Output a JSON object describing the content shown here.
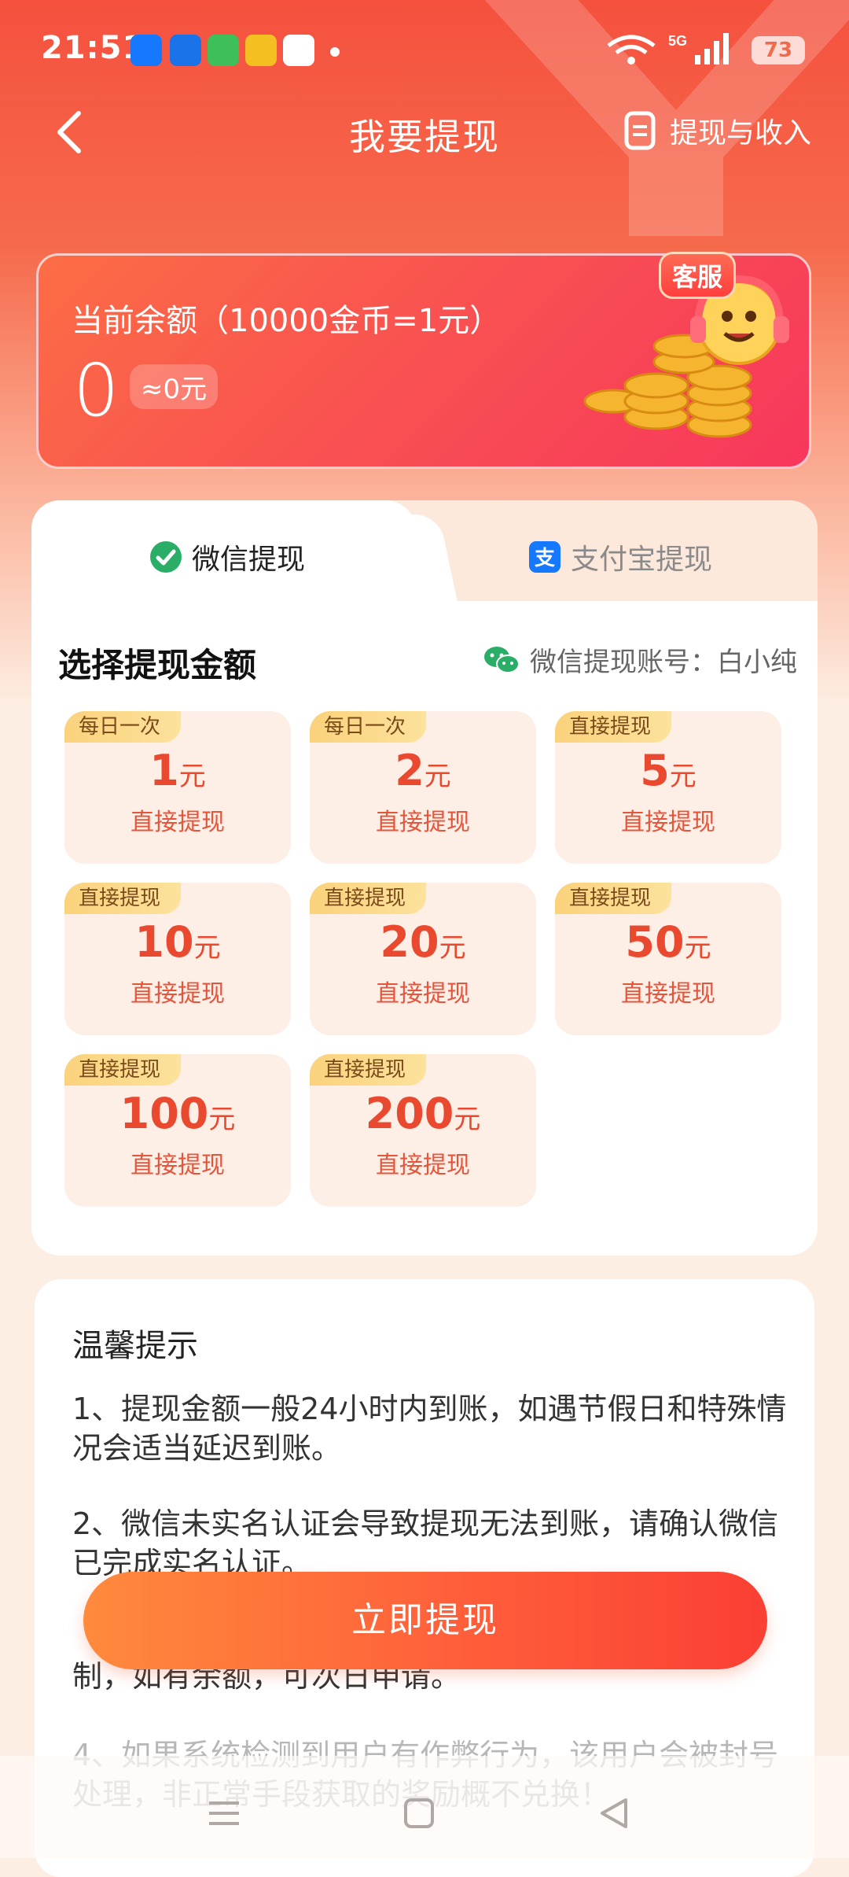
{
  "status_bar": {
    "time": "21:51",
    "network": "5G",
    "battery": "73",
    "app_icons": [
      "alipay-icon",
      "fan-icon",
      "shield-icon",
      "weibo-icon",
      "qq-icon"
    ]
  },
  "header": {
    "title": "我要提现",
    "records_label": "提现与收入"
  },
  "balance": {
    "label": "当前余额（10000金币=1元）",
    "value": "0",
    "approx": "≈0元",
    "service_badge": "客服"
  },
  "tabs": [
    {
      "label": "微信提现",
      "icon": "wechat-icon",
      "active": true
    },
    {
      "label": "支付宝提现",
      "icon": "alipay-icon",
      "active": false
    }
  ],
  "withdraw": {
    "section_title": "选择提现金额",
    "account_label": "微信提现账号：白小纯",
    "unit": "元",
    "options": [
      {
        "badge": "每日一次",
        "amount": "1",
        "subtitle": "直接提现"
      },
      {
        "badge": "每日一次",
        "amount": "2",
        "subtitle": "直接提现"
      },
      {
        "badge": "直接提现",
        "amount": "5",
        "subtitle": "直接提现"
      },
      {
        "badge": "直接提现",
        "amount": "10",
        "subtitle": "直接提现"
      },
      {
        "badge": "直接提现",
        "amount": "20",
        "subtitle": "直接提现"
      },
      {
        "badge": "直接提现",
        "amount": "50",
        "subtitle": "直接提现"
      },
      {
        "badge": "直接提现",
        "amount": "100",
        "subtitle": "直接提现"
      },
      {
        "badge": "直接提现",
        "amount": "200",
        "subtitle": "直接提现"
      }
    ]
  },
  "tips": {
    "title": "温馨提示",
    "items": [
      "1、提现金额一般24小时内到账，如遇节假日和特殊情况会适当延迟到账。",
      "2、微信未实名认证会导致提现无法到账，请确认微信已完成实名认证。",
      "制，如有余额，可次日申请。",
      "4、如果系统检测到用户有作弊行为，该用户会被封号处理，非正常手段获取的奖励概不兑换！"
    ]
  },
  "cta": {
    "label": "立即提现"
  },
  "colors": {
    "brand_red": "#f5513e",
    "amount_text": "#e8492f",
    "badge_gold": "#fbd27c",
    "wechat_green": "#2aae67",
    "alipay_blue": "#1677ff"
  }
}
